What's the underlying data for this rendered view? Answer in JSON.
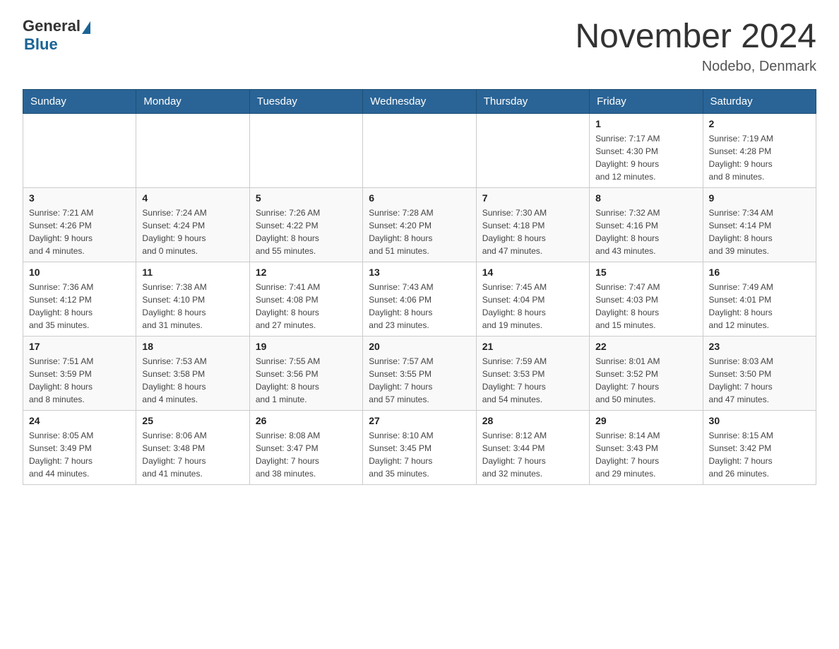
{
  "header": {
    "logo_general": "General",
    "logo_blue": "Blue",
    "title": "November 2024",
    "location": "Nodebo, Denmark"
  },
  "days_of_week": [
    "Sunday",
    "Monday",
    "Tuesday",
    "Wednesday",
    "Thursday",
    "Friday",
    "Saturday"
  ],
  "weeks": [
    [
      {
        "day": "",
        "info": ""
      },
      {
        "day": "",
        "info": ""
      },
      {
        "day": "",
        "info": ""
      },
      {
        "day": "",
        "info": ""
      },
      {
        "day": "",
        "info": ""
      },
      {
        "day": "1",
        "info": "Sunrise: 7:17 AM\nSunset: 4:30 PM\nDaylight: 9 hours\nand 12 minutes."
      },
      {
        "day": "2",
        "info": "Sunrise: 7:19 AM\nSunset: 4:28 PM\nDaylight: 9 hours\nand 8 minutes."
      }
    ],
    [
      {
        "day": "3",
        "info": "Sunrise: 7:21 AM\nSunset: 4:26 PM\nDaylight: 9 hours\nand 4 minutes."
      },
      {
        "day": "4",
        "info": "Sunrise: 7:24 AM\nSunset: 4:24 PM\nDaylight: 9 hours\nand 0 minutes."
      },
      {
        "day": "5",
        "info": "Sunrise: 7:26 AM\nSunset: 4:22 PM\nDaylight: 8 hours\nand 55 minutes."
      },
      {
        "day": "6",
        "info": "Sunrise: 7:28 AM\nSunset: 4:20 PM\nDaylight: 8 hours\nand 51 minutes."
      },
      {
        "day": "7",
        "info": "Sunrise: 7:30 AM\nSunset: 4:18 PM\nDaylight: 8 hours\nand 47 minutes."
      },
      {
        "day": "8",
        "info": "Sunrise: 7:32 AM\nSunset: 4:16 PM\nDaylight: 8 hours\nand 43 minutes."
      },
      {
        "day": "9",
        "info": "Sunrise: 7:34 AM\nSunset: 4:14 PM\nDaylight: 8 hours\nand 39 minutes."
      }
    ],
    [
      {
        "day": "10",
        "info": "Sunrise: 7:36 AM\nSunset: 4:12 PM\nDaylight: 8 hours\nand 35 minutes."
      },
      {
        "day": "11",
        "info": "Sunrise: 7:38 AM\nSunset: 4:10 PM\nDaylight: 8 hours\nand 31 minutes."
      },
      {
        "day": "12",
        "info": "Sunrise: 7:41 AM\nSunset: 4:08 PM\nDaylight: 8 hours\nand 27 minutes."
      },
      {
        "day": "13",
        "info": "Sunrise: 7:43 AM\nSunset: 4:06 PM\nDaylight: 8 hours\nand 23 minutes."
      },
      {
        "day": "14",
        "info": "Sunrise: 7:45 AM\nSunset: 4:04 PM\nDaylight: 8 hours\nand 19 minutes."
      },
      {
        "day": "15",
        "info": "Sunrise: 7:47 AM\nSunset: 4:03 PM\nDaylight: 8 hours\nand 15 minutes."
      },
      {
        "day": "16",
        "info": "Sunrise: 7:49 AM\nSunset: 4:01 PM\nDaylight: 8 hours\nand 12 minutes."
      }
    ],
    [
      {
        "day": "17",
        "info": "Sunrise: 7:51 AM\nSunset: 3:59 PM\nDaylight: 8 hours\nand 8 minutes."
      },
      {
        "day": "18",
        "info": "Sunrise: 7:53 AM\nSunset: 3:58 PM\nDaylight: 8 hours\nand 4 minutes."
      },
      {
        "day": "19",
        "info": "Sunrise: 7:55 AM\nSunset: 3:56 PM\nDaylight: 8 hours\nand 1 minute."
      },
      {
        "day": "20",
        "info": "Sunrise: 7:57 AM\nSunset: 3:55 PM\nDaylight: 7 hours\nand 57 minutes."
      },
      {
        "day": "21",
        "info": "Sunrise: 7:59 AM\nSunset: 3:53 PM\nDaylight: 7 hours\nand 54 minutes."
      },
      {
        "day": "22",
        "info": "Sunrise: 8:01 AM\nSunset: 3:52 PM\nDaylight: 7 hours\nand 50 minutes."
      },
      {
        "day": "23",
        "info": "Sunrise: 8:03 AM\nSunset: 3:50 PM\nDaylight: 7 hours\nand 47 minutes."
      }
    ],
    [
      {
        "day": "24",
        "info": "Sunrise: 8:05 AM\nSunset: 3:49 PM\nDaylight: 7 hours\nand 44 minutes."
      },
      {
        "day": "25",
        "info": "Sunrise: 8:06 AM\nSunset: 3:48 PM\nDaylight: 7 hours\nand 41 minutes."
      },
      {
        "day": "26",
        "info": "Sunrise: 8:08 AM\nSunset: 3:47 PM\nDaylight: 7 hours\nand 38 minutes."
      },
      {
        "day": "27",
        "info": "Sunrise: 8:10 AM\nSunset: 3:45 PM\nDaylight: 7 hours\nand 35 minutes."
      },
      {
        "day": "28",
        "info": "Sunrise: 8:12 AM\nSunset: 3:44 PM\nDaylight: 7 hours\nand 32 minutes."
      },
      {
        "day": "29",
        "info": "Sunrise: 8:14 AM\nSunset: 3:43 PM\nDaylight: 7 hours\nand 29 minutes."
      },
      {
        "day": "30",
        "info": "Sunrise: 8:15 AM\nSunset: 3:42 PM\nDaylight: 7 hours\nand 26 minutes."
      }
    ]
  ]
}
